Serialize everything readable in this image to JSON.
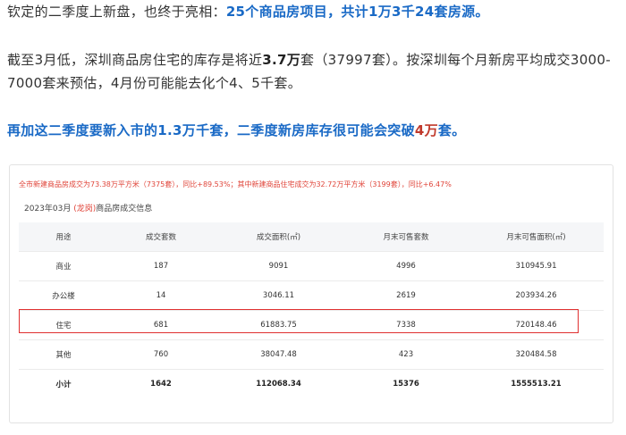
{
  "article": {
    "p1": {
      "text": "钦定的二季度上新盘，也终于亮相：",
      "highlight": "25个商品房项目，共计1万3千24套房源。"
    },
    "p2": {
      "before": "截至3月低，深圳商品房住宅的库存是将近",
      "bold": "3.7万",
      "after": "套（37997套）。按深圳每个月新房平均成交3000-7000套来预估，4月份可能能去化个4、5千套。"
    },
    "p3": {
      "before": "再加这二季度要新入市的1.3万千套，二季度新房库存很可能会突破",
      "red": "4万",
      "after": "套。"
    }
  },
  "card": {
    "notice": "全市新建商品房成交为73.38万平方米（7375套），同比+89.53%；其中新建商品住宅成交为32.72万平方米（3199套），同比+6.47%",
    "subtitle_date": "2023年03月",
    "subtitle_district": "(龙岗)",
    "subtitle_label": "商品房成交信息",
    "headers": [
      "用途",
      "成交套数",
      "成交面积(㎡)",
      "月末可售套数",
      "月末可售面积(㎡)"
    ],
    "rows": [
      [
        "商业",
        "187",
        "9091",
        "4996",
        "310945.91"
      ],
      [
        "办公楼",
        "14",
        "3046.11",
        "2619",
        "203934.26"
      ],
      [
        "住宅",
        "681",
        "61883.75",
        "7338",
        "720148.46"
      ],
      [
        "其他",
        "760",
        "38047.48",
        "423",
        "320484.58"
      ]
    ],
    "total": [
      "小计",
      "1642",
      "112068.34",
      "15376",
      "1555513.21"
    ],
    "highlight_color": "#e03030"
  }
}
